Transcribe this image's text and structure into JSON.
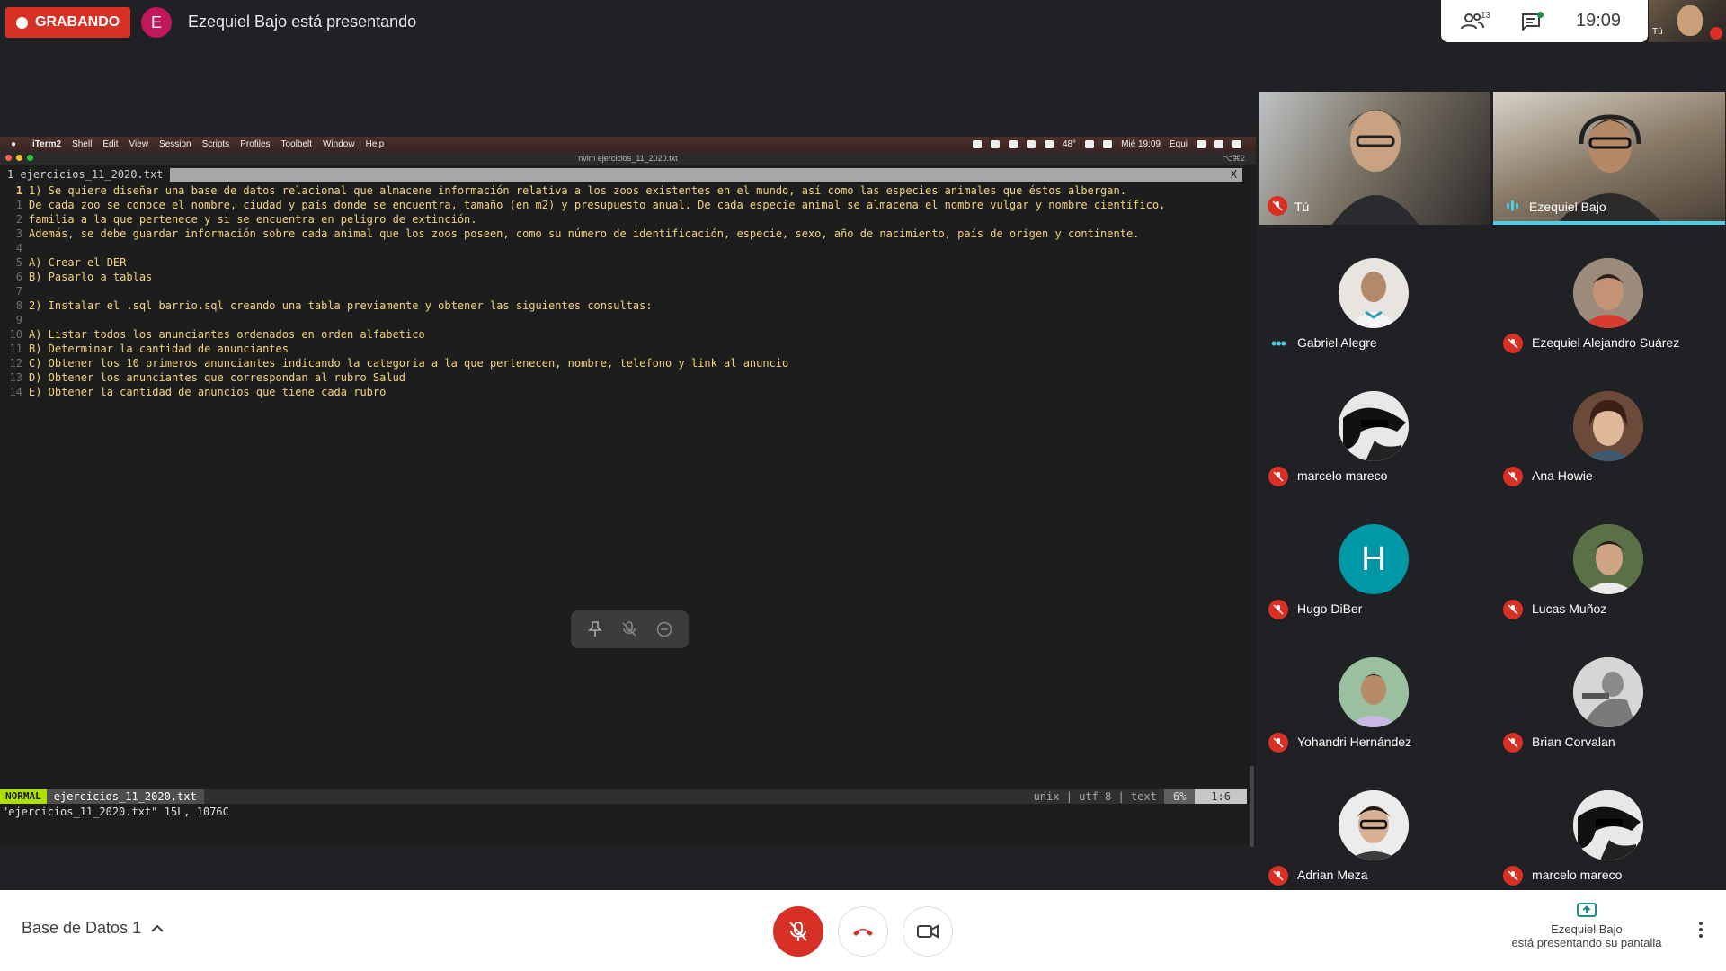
{
  "recording": {
    "label": "GRABANDO",
    "color": "#d93025"
  },
  "presenter": {
    "initial": "E",
    "status_text": "Ezequiel Bajo está presentando"
  },
  "info_panel": {
    "people_count": "13",
    "clock": "19:09",
    "self_label": "Tú"
  },
  "mac_menubar": {
    "app": "iTerm2",
    "items": [
      "Shell",
      "Edit",
      "View",
      "Session",
      "Scripts",
      "Profiles",
      "Toolbelt",
      "Window",
      "Help"
    ],
    "right": {
      "temp": "48°",
      "datetime": "Mié 19:09",
      "user": "Equi"
    }
  },
  "terminal": {
    "title": "nvim ejercicios_11_2020.txt",
    "shortcut": "⌥⌘2"
  },
  "editor": {
    "tab_label": "1 ejercicios_11_2020.txt",
    "tab_close": "X",
    "lines": [
      {
        "num": "1",
        "text": "1) Se quiere diseñar una base de datos relacional que almacene información relativa a los zoos existentes en el mundo, así como las especies animales que éstos albergan.",
        "current": true
      },
      {
        "num": "1",
        "text": "De cada zoo se conoce el nombre, ciudad y país donde se encuentra, tamaño (en m2) y presupuesto anual. De cada especie animal se almacena el nombre vulgar y nombre científico,"
      },
      {
        "num": "2",
        "text": "familia a la que pertenece y si se encuentra en peligro de extinción."
      },
      {
        "num": "3",
        "text": "Además, se debe guardar información sobre cada animal que los zoos poseen, como su número de identificación, especie, sexo, año de nacimiento, país de origen y continente."
      },
      {
        "num": "4",
        "text": ""
      },
      {
        "num": "5",
        "text": "A) Crear el DER"
      },
      {
        "num": "6",
        "text": "B) Pasarlo a tablas"
      },
      {
        "num": "7",
        "text": ""
      },
      {
        "num": "8",
        "text": "2) Instalar el .sql barrio.sql creando una tabla previamente y obtener las siguientes consultas:"
      },
      {
        "num": "9",
        "text": ""
      },
      {
        "num": "10",
        "text": "A) Listar todos los anunciantes ordenados en orden alfabetico"
      },
      {
        "num": "11",
        "text": "B) Determinar la cantidad de anunciantes"
      },
      {
        "num": "12",
        "text": "C) Obtener los 10 primeros anunciantes indicando la categoria a la que pertenecen, nombre, telefono y link al anuncio"
      },
      {
        "num": "13",
        "text": "D) Obtener los anunciantes que correspondan al rubro Salud"
      },
      {
        "num": "14",
        "text": "E) Obtener la cantidad de anuncios que tiene cada rubro"
      }
    ],
    "status": {
      "mode": "NORMAL",
      "filename": "ejercicios_11_2020.txt",
      "encoding": "unix | utf-8 | text",
      "percent": "6%",
      "position": "1:6"
    },
    "cmdline": "\"ejercicios_11_2020.txt\" 15L, 1076C"
  },
  "video_tiles": [
    {
      "name": "Tú",
      "muted": true
    },
    {
      "name": "Ezequiel Bajo",
      "speaking": true
    }
  ],
  "participants": [
    {
      "name": "Gabriel Alegre",
      "state": "dots",
      "avatar_color": "#e8e4df"
    },
    {
      "name": "Ezequiel Alejandro Suárez",
      "state": "muted",
      "avatar_color": "#b08a70"
    },
    {
      "name": "marcelo mareco",
      "state": "muted",
      "avatar_color": "#d8d8d8"
    },
    {
      "name": "Ana Howie",
      "state": "muted",
      "avatar_color": "#7a5a48"
    },
    {
      "name": "Hugo DiBer",
      "state": "muted",
      "avatar_color": "#0097a7",
      "initial": "H"
    },
    {
      "name": "Lucas Muñoz",
      "state": "muted",
      "avatar_color": "#6a7a5a"
    },
    {
      "name": "Yohandri Hernández",
      "state": "muted",
      "avatar_color": "#8ab0d0"
    },
    {
      "name": "Brian Corvalan",
      "state": "muted",
      "avatar_color": "#cfcfcf"
    },
    {
      "name": "Adrian Meza",
      "state": "muted",
      "avatar_color": "#e0e0e0"
    },
    {
      "name": "marcelo mareco",
      "state": "muted",
      "avatar_color": "#d8d8d8"
    }
  ],
  "bottom": {
    "meeting_title": "Base de Datos 1",
    "presenting_name": "Ezequiel Bajo",
    "presenting_sub": "está presentando su pantalla"
  }
}
